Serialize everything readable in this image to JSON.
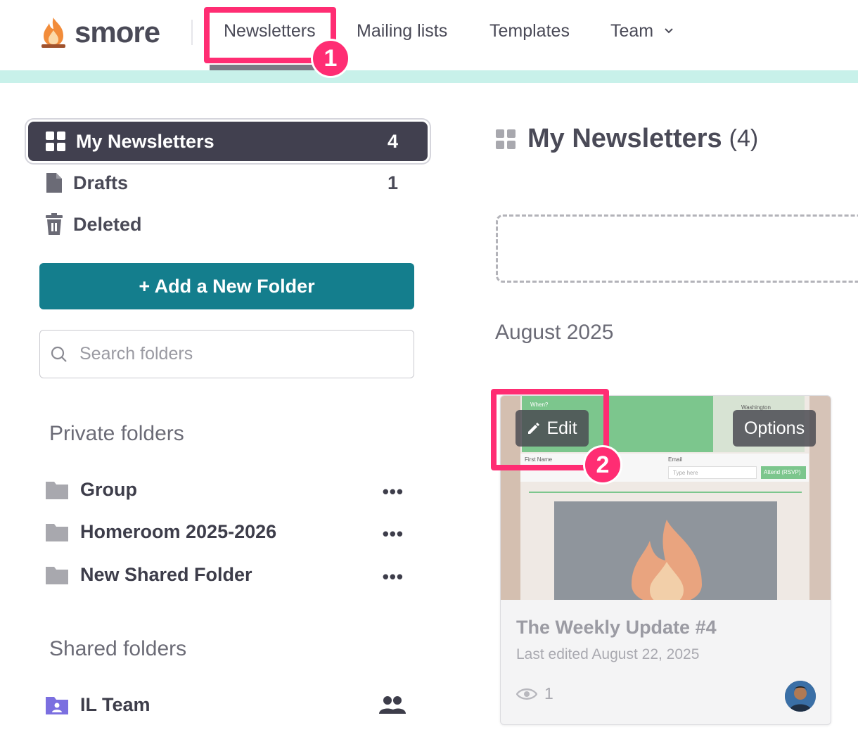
{
  "app": {
    "logo_text": "smore"
  },
  "nav": {
    "items": [
      {
        "label": "Newsletters"
      },
      {
        "label": "Mailing lists"
      },
      {
        "label": "Templates"
      },
      {
        "label": "Team"
      }
    ],
    "active": "Newsletters"
  },
  "annotations": {
    "badge1": "1",
    "badge2": "2",
    "color": "#ff2d73"
  },
  "sidebar": {
    "items": [
      {
        "label": "My Newsletters",
        "count": "4",
        "icon": "grid-icon"
      },
      {
        "label": "Drafts",
        "count": "1",
        "icon": "document-icon"
      },
      {
        "label": "Deleted",
        "count": "",
        "icon": "trash-icon"
      }
    ],
    "add_folder_label": "+ Add a New Folder",
    "search_placeholder": "Search folders",
    "private_title": "Private folders",
    "private_folders": [
      {
        "label": "Group"
      },
      {
        "label": "Homeroom 2025-2026"
      },
      {
        "label": "New Shared Folder"
      }
    ],
    "shared_title": "Shared folders",
    "shared_folders": [
      {
        "label": "IL Team"
      }
    ]
  },
  "main": {
    "title": "My Newsletters",
    "count": "(4)",
    "month": "August 2025",
    "card": {
      "title": "The Weekly Update #4",
      "meta": "Last edited August 22, 2025",
      "views": "1",
      "edit_label": "Edit",
      "options_label": "Options",
      "thumb_texts": [
        "When?",
        "First Name",
        "Email",
        "Attend (RSVP)",
        "Washington",
        "Type here"
      ]
    }
  },
  "colors": {
    "accent": "#147e8d",
    "dark": "#41404f",
    "teal_strip": "#c8f1ea"
  }
}
